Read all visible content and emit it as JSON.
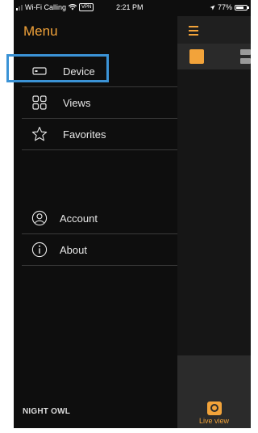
{
  "status_bar": {
    "carrier": "Wi-Fi Calling",
    "vpn": "VPN",
    "time": "2:21 PM",
    "battery": "77%"
  },
  "menu": {
    "title": "Menu",
    "items": [
      {
        "label": "Device",
        "icon": "device-icon"
      },
      {
        "label": "Views",
        "icon": "grid-icon"
      },
      {
        "label": "Favorites",
        "icon": "star-icon"
      },
      {
        "label": "Account",
        "icon": "account-icon"
      },
      {
        "label": "About",
        "icon": "info-icon"
      }
    ]
  },
  "brand": "NIGHT OWL",
  "main": {
    "bottom_tab": "Live view"
  },
  "colors": {
    "accent": "#f2a33a",
    "highlight": "#3b93d6",
    "background": "#0e0e0e"
  }
}
